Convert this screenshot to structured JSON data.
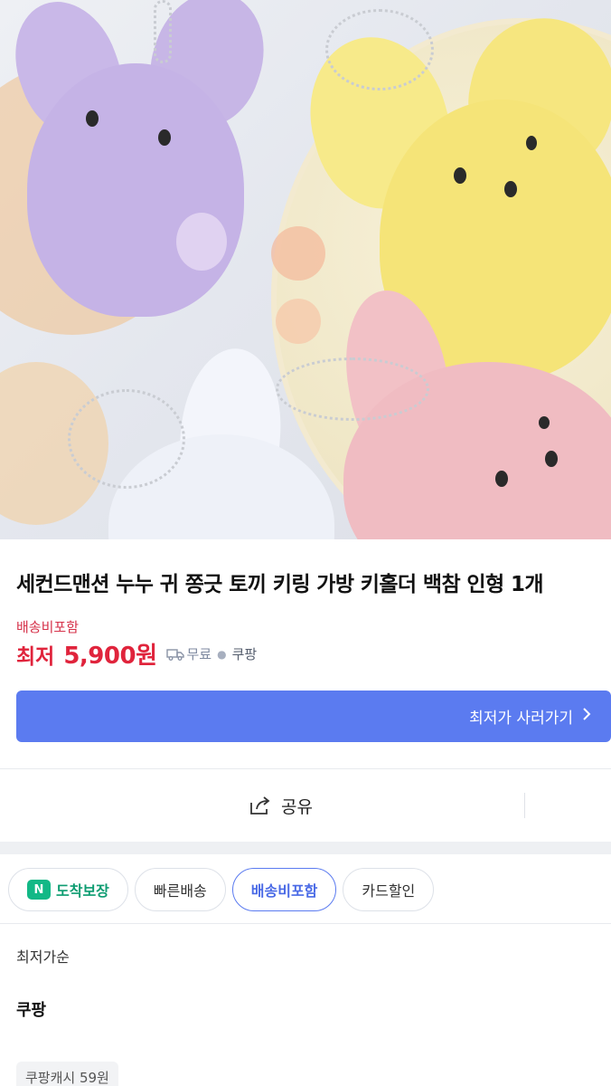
{
  "product": {
    "title": "세컨드맨션 누누 귀 쫑긋 토끼 키링 가방 키홀더 백참 인형 1개",
    "shipping_included": "배송비포함",
    "price_label": "최저",
    "price_value": "5,900원",
    "delivery_fee": "무료",
    "seller": "쿠팡"
  },
  "cta": {
    "label": "최저가 사러가기",
    "icon": "chevron-right-icon"
  },
  "share": {
    "label": "공유",
    "icon": "share-icon"
  },
  "filters": [
    {
      "label": "도착보장",
      "badge": "N",
      "active": false
    },
    {
      "label": "빠른배송",
      "active": false
    },
    {
      "label": "배송비포함",
      "active": true
    },
    {
      "label": "카드할인",
      "active": false
    }
  ],
  "sort": {
    "label": "최저가순"
  },
  "listing": {
    "seller": "쿠팡",
    "cash_badge": "쿠팡캐시 59원"
  },
  "colors": {
    "accent": "#5b7bf0",
    "price_red": "#e0243c",
    "arrival_green": "#12b886"
  }
}
